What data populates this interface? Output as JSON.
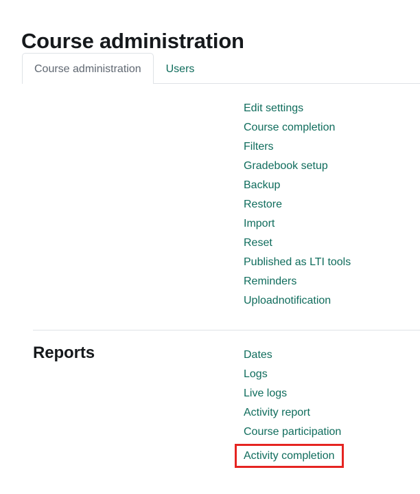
{
  "page": {
    "title": "Course administration"
  },
  "tabs": [
    {
      "label": "Course administration",
      "active": true
    },
    {
      "label": "Users",
      "active": false
    }
  ],
  "sections": [
    {
      "heading": "",
      "items": [
        {
          "label": "Edit settings",
          "highlighted": false
        },
        {
          "label": "Course completion",
          "highlighted": false
        },
        {
          "label": "Filters",
          "highlighted": false
        },
        {
          "label": "Gradebook setup",
          "highlighted": false
        },
        {
          "label": "Backup",
          "highlighted": false
        },
        {
          "label": "Restore",
          "highlighted": false
        },
        {
          "label": "Import",
          "highlighted": false
        },
        {
          "label": "Reset",
          "highlighted": false
        },
        {
          "label": "Published as LTI tools",
          "highlighted": false
        },
        {
          "label": "Reminders",
          "highlighted": false
        },
        {
          "label": "Uploadnotification",
          "highlighted": false
        }
      ]
    },
    {
      "heading": "Reports",
      "items": [
        {
          "label": "Dates",
          "highlighted": false
        },
        {
          "label": "Logs",
          "highlighted": false
        },
        {
          "label": "Live logs",
          "highlighted": false
        },
        {
          "label": "Activity report",
          "highlighted": false
        },
        {
          "label": "Course participation",
          "highlighted": false
        },
        {
          "label": "Activity completion",
          "highlighted": true
        }
      ]
    }
  ],
  "colors": {
    "link": "#0f6c5c",
    "heading": "#16191c",
    "active_tab_text": "#5f6771",
    "border": "#dee2e6",
    "highlight": "#e52421",
    "background": "#ffffff"
  }
}
